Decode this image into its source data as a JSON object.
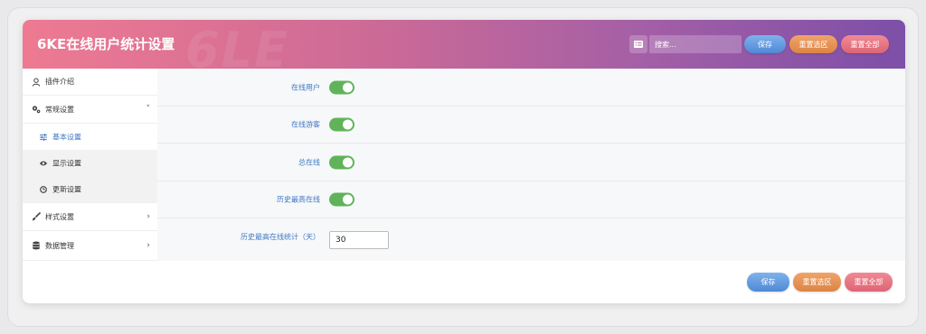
{
  "header": {
    "title": "6KE在线用户统计设置",
    "watermark": "6LE",
    "search_placeholder": "搜索...",
    "save_label": "保存",
    "reset_section_label": "重置选区",
    "reset_all_label": "重置全部"
  },
  "sidebar": {
    "items": [
      {
        "label": "插件介绍",
        "icon": "user-icon",
        "arrow": ""
      },
      {
        "label": "常规设置",
        "icon": "gears-icon",
        "arrow": "˅"
      },
      {
        "label": "样式设置",
        "icon": "brush-icon",
        "arrow": "›"
      },
      {
        "label": "数据管理",
        "icon": "database-icon",
        "arrow": "›"
      }
    ],
    "subitems": [
      {
        "label": "基本设置",
        "icon": "sliders-icon",
        "active": true
      },
      {
        "label": "显示设置",
        "icon": "eye-icon",
        "active": false
      },
      {
        "label": "更新设置",
        "icon": "clock-icon",
        "active": false
      }
    ]
  },
  "settings": {
    "online_users_label": "在线用户",
    "online_users_enabled": true,
    "online_guests_label": "在线游客",
    "online_guests_enabled": true,
    "total_online_label": "总在线",
    "total_online_enabled": true,
    "history_peak_label": "历史最高在线",
    "history_peak_enabled": true,
    "history_peak_days_label": "历史最高在线统计（天）",
    "history_peak_days_value": "30"
  },
  "footer": {
    "save_label": "保存",
    "reset_section_label": "重置选区",
    "reset_all_label": "重置全部"
  },
  "colors": {
    "header_gradient_start": "#ee7a92",
    "header_gradient_end": "#7d4fa8",
    "accent_blue": "#3f78c2",
    "toggle_green": "#61b35a",
    "save_blue": "#4f88d6",
    "reset_orange": "#dc8444",
    "reset_pink": "#de6474"
  }
}
